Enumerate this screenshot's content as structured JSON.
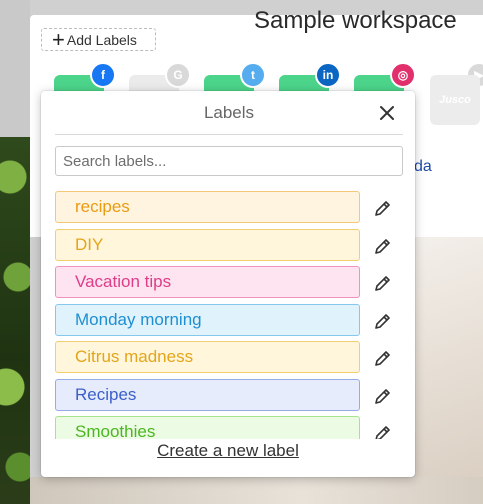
{
  "workspace": {
    "title": "Sample workspace",
    "add_labels_label": "Add Labels",
    "partial_link_text": "da",
    "jusco_text": "Jusco"
  },
  "social": [
    {
      "name": "facebook",
      "badge_color": "#1877f2",
      "tile_color": "#4bd48a",
      "glyph": "f"
    },
    {
      "name": "google",
      "badge_color": "#d9d9d9",
      "tile_color": "#ebebeb",
      "glyph": "G"
    },
    {
      "name": "twitter",
      "badge_color": "#55acee",
      "tile_color": "#4bd48a",
      "glyph": "t"
    },
    {
      "name": "linkedin",
      "badge_color": "#0a66c2",
      "tile_color": "#4bd48a",
      "glyph": "in"
    },
    {
      "name": "instagram",
      "badge_color": "#e1306c",
      "tile_color": "#4bd48a",
      "glyph": "◎"
    },
    {
      "name": "youtube",
      "badge_color": "#d9d9d9",
      "tile_color": "#ececec",
      "glyph": "▶"
    }
  ],
  "popover": {
    "title": "Labels",
    "search_placeholder": "Search labels...",
    "search_value": "",
    "create_label": "Create a new label",
    "labels": [
      {
        "text": "recipes",
        "bg": "#fff4e0",
        "border": "#f5c877",
        "color": "#e89c12"
      },
      {
        "text": "DIY",
        "bg": "#fff6dc",
        "border": "#f3cf6e",
        "color": "#e3a51a"
      },
      {
        "text": "Vacation tips",
        "bg": "#fde4f0",
        "border": "#ef92bd",
        "color": "#de3d88"
      },
      {
        "text": "Monday morning",
        "bg": "#e0f2fc",
        "border": "#86c8ec",
        "color": "#1e8fd1"
      },
      {
        "text": "Citrus madness",
        "bg": "#fff6dc",
        "border": "#f3cf6e",
        "color": "#e3a51a"
      },
      {
        "text": "Recipes",
        "bg": "#e6ecfb",
        "border": "#97abe6",
        "color": "#3a5fc9"
      },
      {
        "text": "Smoothies",
        "bg": "#ecfbe4",
        "border": "#a7e38a",
        "color": "#4cb620"
      }
    ]
  }
}
